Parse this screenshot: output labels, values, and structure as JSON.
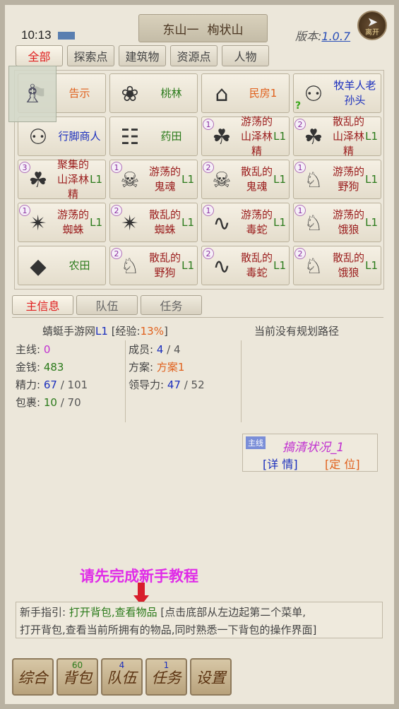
{
  "header": {
    "time": "10:13",
    "location_a": "东山一",
    "location_b": "栒状山",
    "version_label": "版本:",
    "version_num": "1.0.7",
    "leave_label": "离开"
  },
  "category_tabs": [
    "全部",
    "探索点",
    "建筑物",
    "资源点",
    "人物"
  ],
  "grid": [
    {
      "name": "告示",
      "icon": "notice-icon",
      "color": "orange"
    },
    {
      "name": "桃林",
      "icon": "peach-tree-icon",
      "color": "green"
    },
    {
      "name": "民房1",
      "icon": "house-icon",
      "color": "orange"
    },
    {
      "name": "牧羊人老孙头",
      "icon": "shepherd-icon",
      "color": "blue",
      "quest": "?"
    },
    {
      "name": "行脚商人",
      "icon": "merchant-icon",
      "color": "blue"
    },
    {
      "name": "药田",
      "icon": "herb-field-icon",
      "color": "green"
    },
    {
      "name": "游荡的山泽林精",
      "level": "L1",
      "icon": "forest-spirit-icon",
      "color": "red",
      "badge": "1"
    },
    {
      "name": "散乱的山泽林精",
      "level": "L1",
      "icon": "forest-spirit-icon",
      "color": "red",
      "badge": "2"
    },
    {
      "name": "聚集的山泽林精",
      "level": "L1",
      "icon": "forest-spirit-icon",
      "color": "red",
      "badge": "3"
    },
    {
      "name": "游荡的鬼魂",
      "level": "L1",
      "icon": "ghost-icon",
      "color": "red",
      "badge": "1"
    },
    {
      "name": "散乱的鬼魂",
      "level": "L1",
      "icon": "ghost-icon",
      "color": "red",
      "badge": "2"
    },
    {
      "name": "游荡的野狗",
      "level": "L1",
      "icon": "dog-icon",
      "color": "red",
      "badge": "1"
    },
    {
      "name": "游荡的蜘蛛",
      "level": "L1",
      "icon": "spider-icon",
      "color": "red",
      "badge": "1"
    },
    {
      "name": "散乱的蜘蛛",
      "level": "L1",
      "icon": "spider-icon",
      "color": "red",
      "badge": "2"
    },
    {
      "name": "游荡的毒蛇",
      "level": "L1",
      "icon": "snake-icon",
      "color": "red",
      "badge": "1"
    },
    {
      "name": "游荡的饿狼",
      "level": "L1",
      "icon": "wolf-icon",
      "color": "red",
      "badge": "1"
    },
    {
      "name": "农田",
      "icon": "farmland-icon",
      "color": "green"
    },
    {
      "name": "散乱的野狗",
      "level": "L1",
      "icon": "dog-icon",
      "color": "red",
      "badge": "2"
    },
    {
      "name": "散乱的毒蛇",
      "level": "L1",
      "icon": "snake-icon",
      "color": "red",
      "badge": "2"
    },
    {
      "name": "散乱的饿狼",
      "level": "L1",
      "icon": "wolf-icon",
      "color": "red",
      "badge": "2"
    }
  ],
  "info_tabs": [
    "主信息",
    "队伍",
    "任务"
  ],
  "player": {
    "name": "蜻蜓手游网",
    "level": "L1",
    "exp_label": "[经验:",
    "exp_value": "13%",
    "exp_close": "]"
  },
  "stats_left": [
    {
      "label": "主线:",
      "value": "0",
      "color": "purple"
    },
    {
      "label": "金钱:",
      "value": "483",
      "color": "green"
    },
    {
      "label": "精力:",
      "value": "67",
      "max": "/ 101",
      "color": "blue"
    },
    {
      "label": "包裹:",
      "value": "10",
      "max": "/ 70",
      "color": "green"
    }
  ],
  "stats_right": [
    {
      "label": "成员:",
      "value": "4",
      "max": "/ 4",
      "color": "blue"
    },
    {
      "label": "方案:",
      "value": "方案1",
      "color": "orange"
    },
    {
      "label": "领导力:",
      "value": "47",
      "max": "/ 52",
      "color": "blue"
    }
  ],
  "route_text": "当前没有规划路径",
  "quest": {
    "tag": "主线",
    "name": "搞清状况_1",
    "detail": "[详 情]",
    "locate": "[定 位]"
  },
  "prompt": "请先完成新手教程",
  "guide": {
    "prefix": "新手指引:",
    "action": "打开背包,查看物品",
    "desc_1": "[点击底部从左边起第二个菜单,",
    "desc_2": "打开背包,查看当前所拥有的物品,同时熟悉一下背包的操作界面]"
  },
  "bottom": [
    {
      "label": "综合"
    },
    {
      "label": "背包",
      "count": "60"
    },
    {
      "label": "队伍",
      "count": "4"
    },
    {
      "label": "任务",
      "count": "1"
    },
    {
      "label": "设置"
    }
  ]
}
